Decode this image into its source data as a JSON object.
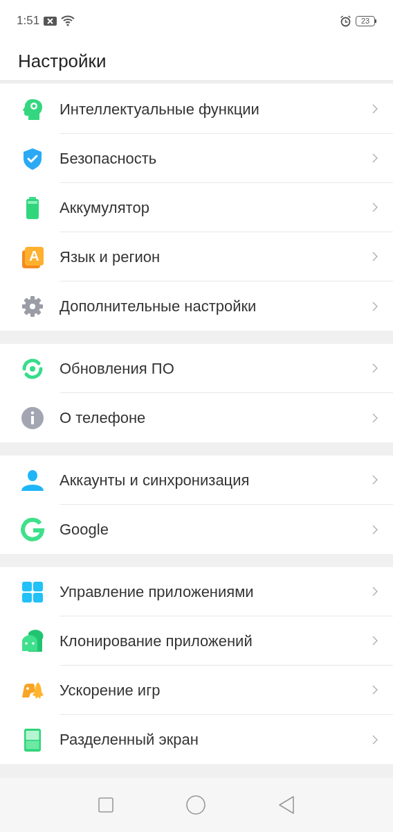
{
  "status_bar": {
    "time": "1:51",
    "battery": "23"
  },
  "title": "Настройки",
  "groups": [
    {
      "items": [
        {
          "label": "Интеллектуальные функции"
        },
        {
          "label": "Безопасность"
        },
        {
          "label": "Аккумулятор"
        },
        {
          "label": "Язык и регион",
          "icon_letter": "A"
        },
        {
          "label": "Дополнительные настройки"
        }
      ]
    },
    {
      "items": [
        {
          "label": "Обновления ПО"
        },
        {
          "label": "О телефоне"
        }
      ]
    },
    {
      "items": [
        {
          "label": "Аккаунты и синхронизация"
        },
        {
          "label": "Google"
        }
      ]
    },
    {
      "items": [
        {
          "label": "Управление приложениями"
        },
        {
          "label": "Клонирование приложений"
        },
        {
          "label": "Ускорение игр"
        },
        {
          "label": "Разделенный экран"
        }
      ]
    }
  ]
}
